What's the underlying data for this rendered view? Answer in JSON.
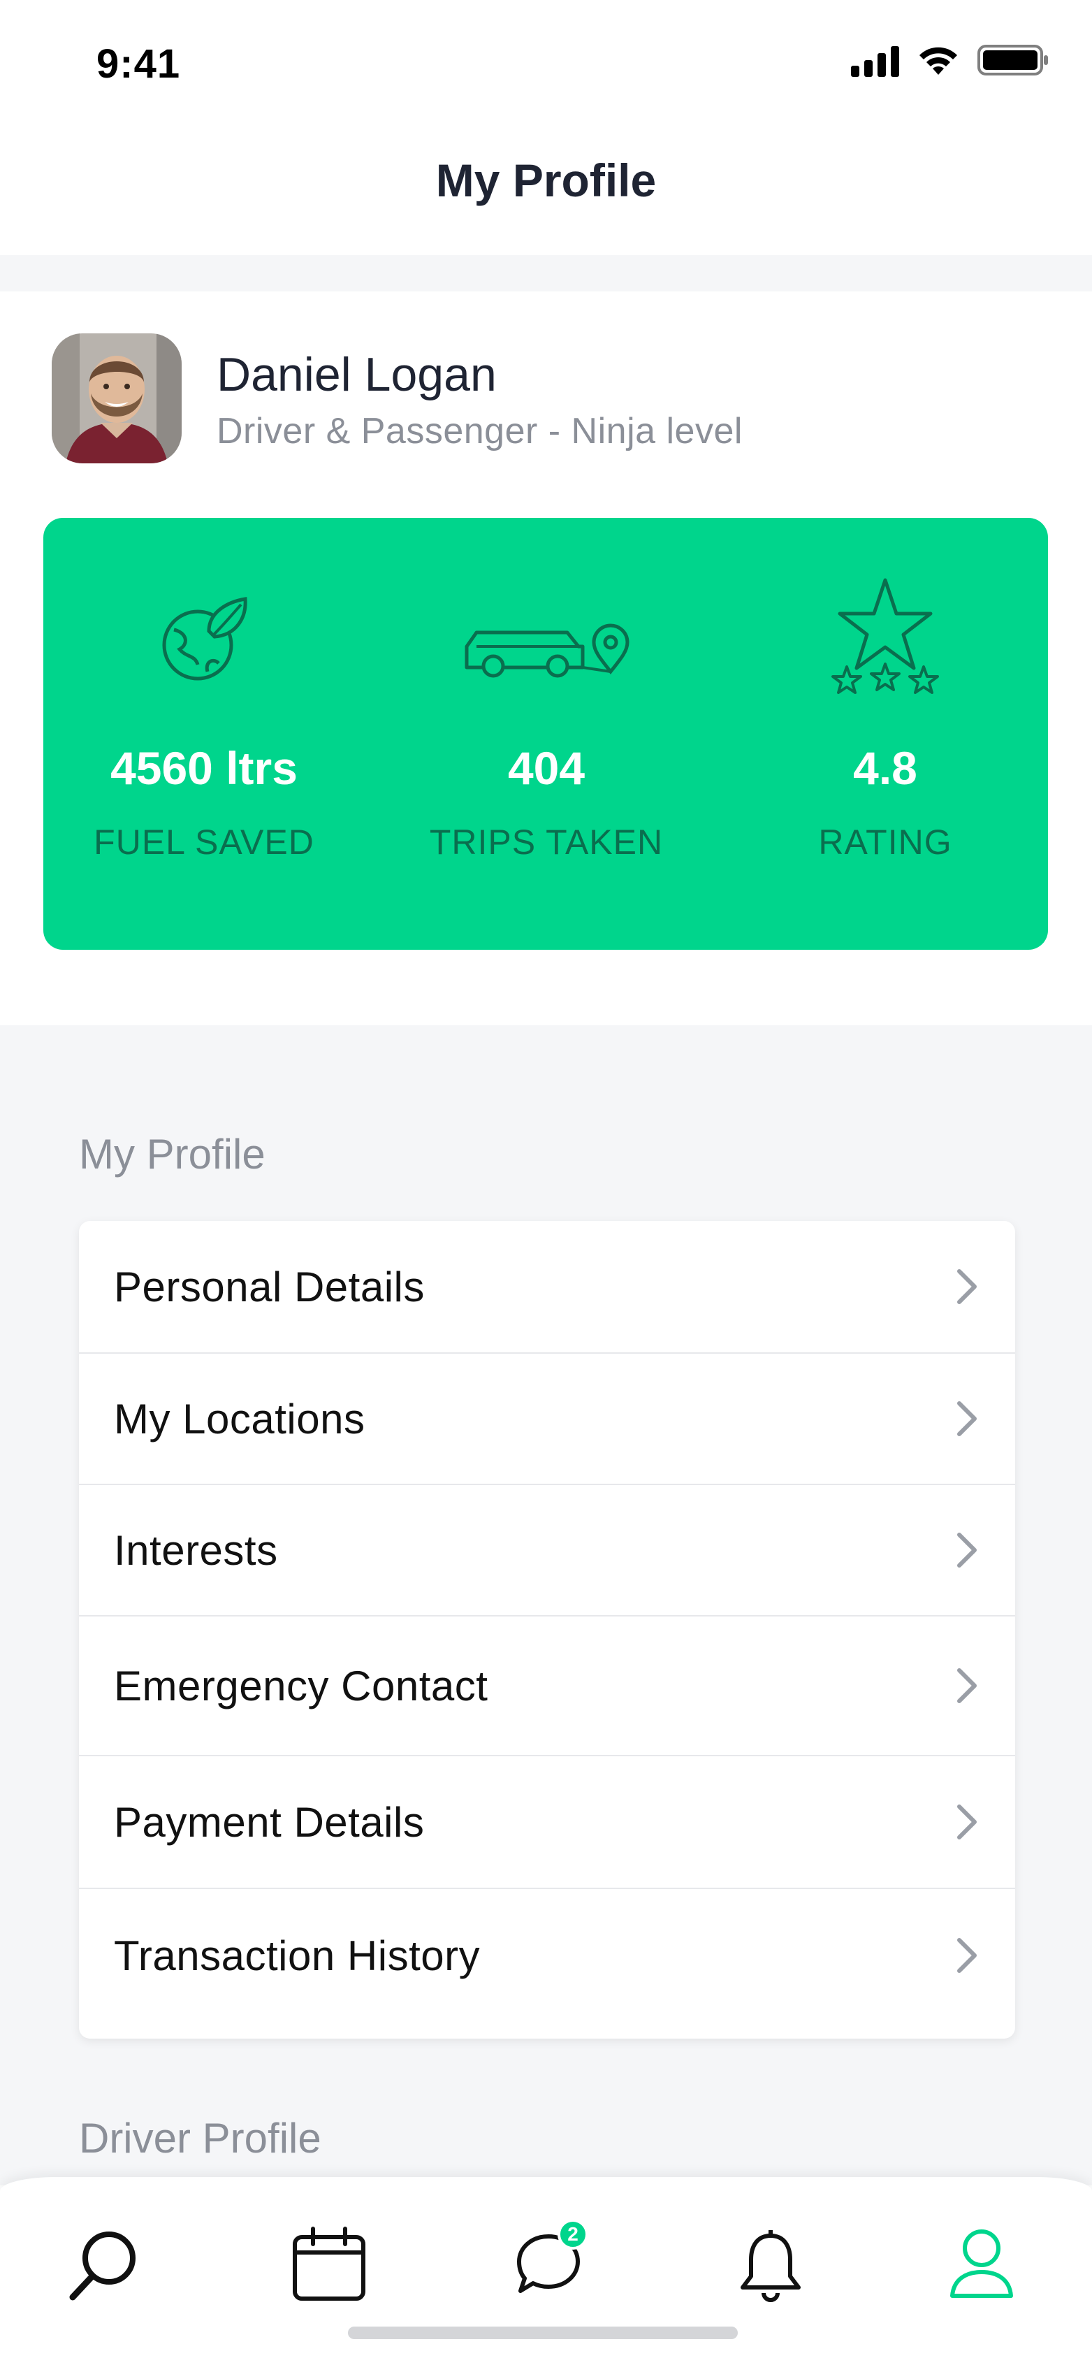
{
  "status_bar": {
    "time": "9:41"
  },
  "header": {
    "title": "My Profile"
  },
  "user": {
    "name": "Daniel Logan",
    "role": "Driver & Passenger - Ninja level"
  },
  "stats": [
    {
      "icon": "leaf-globe-icon",
      "value": "4560 ltrs",
      "label": "FUEL SAVED"
    },
    {
      "icon": "car-location-icon",
      "value": "404",
      "label": "TRIPS TAKEN"
    },
    {
      "icon": "star-rating-icon",
      "value": "4.8",
      "label": "RATING"
    }
  ],
  "sections": {
    "my_profile": {
      "title": "My Profile",
      "items": [
        {
          "label": "Personal Details"
        },
        {
          "label": "My Locations"
        },
        {
          "label": "Interests"
        },
        {
          "label": "Emergency Contact"
        },
        {
          "label": "Payment Details"
        },
        {
          "label": "Transaction History"
        }
      ]
    },
    "driver_profile": {
      "title": "Driver Profile"
    }
  },
  "bottom_nav": {
    "items": [
      {
        "icon": "search-icon"
      },
      {
        "icon": "calendar-icon"
      },
      {
        "icon": "chat-icon",
        "badge": "2"
      },
      {
        "icon": "bell-icon"
      },
      {
        "icon": "user-icon",
        "active": true
      }
    ]
  },
  "colors": {
    "accent": "#00d58c",
    "stat_label": "#0a6e4e",
    "text_primary": "#1f2433",
    "text_secondary": "#8b8f98",
    "background_gray": "#f5f6f8"
  }
}
